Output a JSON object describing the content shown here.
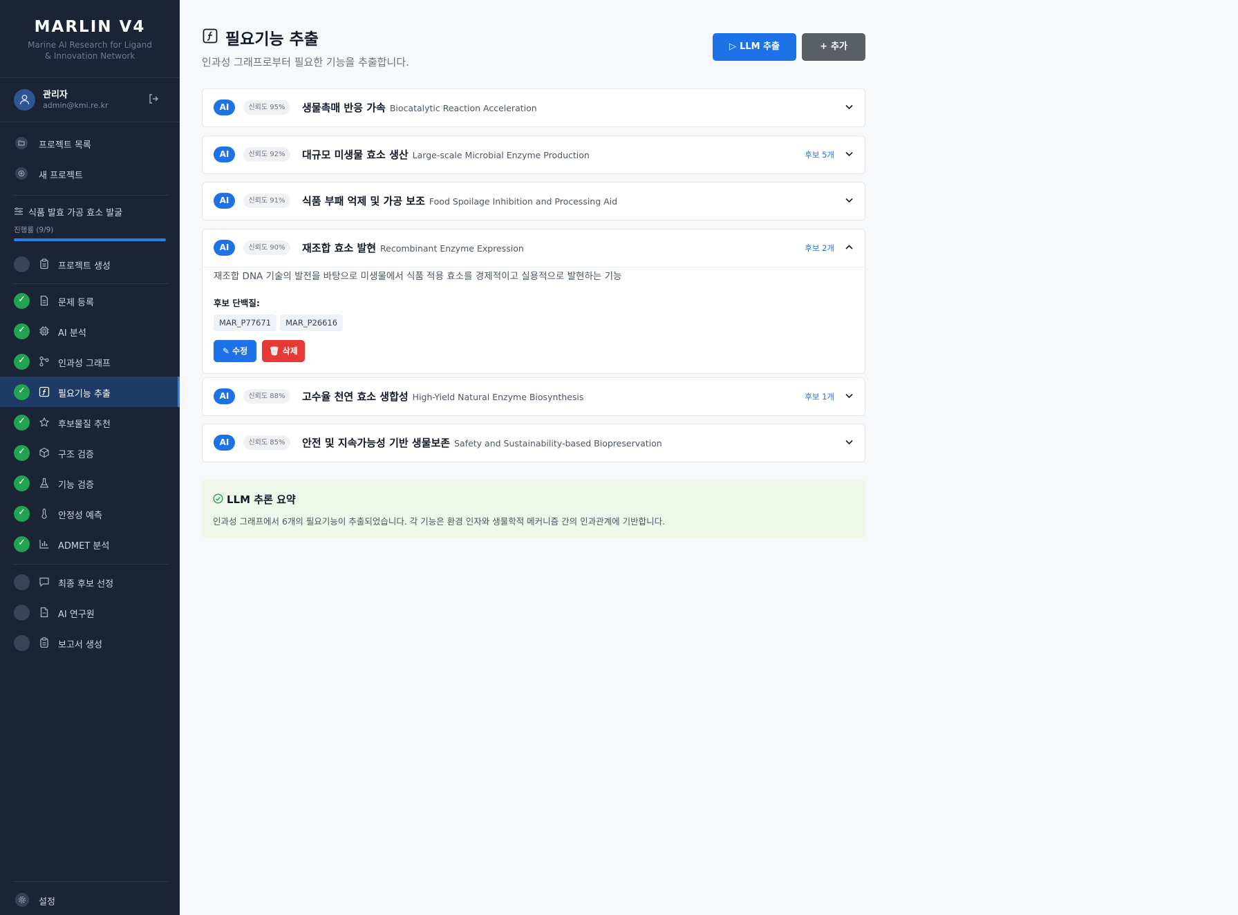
{
  "brand": {
    "title": "MARLIN V4",
    "subtitle_line1": "Marine AI Research for Ligand",
    "subtitle_line2": "& Innovation Network"
  },
  "user": {
    "name": "관리자",
    "email": "admin@kmi.re.kr"
  },
  "nav": {
    "project_list": "프로젝트 목록",
    "new_project": "새 프로젝트"
  },
  "project": {
    "title": "식품 발효 가공 효소 발굴",
    "progress_label": "진행률 (9/9)",
    "progress": 1.0
  },
  "steps": [
    {
      "label": "프로젝트 생성",
      "done": false,
      "icon": "clipboard-icon"
    },
    {
      "label": "문제 등록",
      "done": true,
      "icon": "document-icon"
    },
    {
      "label": "AI 분석",
      "done": true,
      "icon": "cpu-icon"
    },
    {
      "label": "인과성 그래프",
      "done": true,
      "icon": "graph-icon"
    },
    {
      "label": "필요기능 추출",
      "done": true,
      "icon": "function-icon",
      "active": true
    },
    {
      "label": "후보물질 추천",
      "done": true,
      "icon": "star-icon"
    },
    {
      "label": "구조 검증",
      "done": true,
      "icon": "cube-icon"
    },
    {
      "label": "기능 검증",
      "done": true,
      "icon": "flask-icon"
    },
    {
      "label": "안정성 예측",
      "done": true,
      "icon": "thermometer-icon"
    },
    {
      "label": "ADMET 분석",
      "done": true,
      "icon": "bar-chart-icon"
    },
    {
      "label": "최종 후보 선정",
      "done": false,
      "icon": "message-icon"
    },
    {
      "label": "AI 연구원",
      "done": false,
      "icon": "file-icon"
    },
    {
      "label": "보고서 생성",
      "done": false,
      "icon": "clipboard-icon"
    }
  ],
  "settings_label": "설정",
  "header": {
    "title": "필요기능 추출",
    "subtitle": "인과성 그래프로부터 필요한 기능을 추출합니다.",
    "llm_button": "LLM 추출",
    "add_button": "추가"
  },
  "functions": [
    {
      "badge": "AI",
      "confidence": "신뢰도 95%",
      "title": "생물촉매 반응 가속",
      "title_en": "Biocatalytic Reaction Acceleration",
      "candidates": "",
      "expanded": false
    },
    {
      "badge": "AI",
      "confidence": "신뢰도 92%",
      "title": "대규모 미생물 효소 생산",
      "title_en": "Large-scale Microbial Enzyme Production",
      "candidates": "후보 5개",
      "expanded": false
    },
    {
      "badge": "AI",
      "confidence": "신뢰도 91%",
      "title": "식품 부패 억제 및 가공 보조",
      "title_en": "Food Spoilage Inhibition and Processing Aid",
      "candidates": "",
      "expanded": false
    },
    {
      "badge": "AI",
      "confidence": "신뢰도 90%",
      "title": "재조합 효소 발현",
      "title_en": "Recombinant Enzyme Expression",
      "candidates": "후보 2개",
      "expanded": true,
      "description": "재조합 DNA 기술의 발전을 바탕으로 미생물에서 식품 적용 효소를 경제적이고 실용적으로 발현하는 기능",
      "candidate_label": "후보 단백질:",
      "proteins": [
        "MAR_P77671",
        "MAR_P26616"
      ],
      "edit_button": "수정",
      "delete_button": "삭제"
    },
    {
      "badge": "AI",
      "confidence": "신뢰도 88%",
      "title": "고수율 천연 효소 생합성",
      "title_en": "High-Yield Natural Enzyme Biosynthesis",
      "candidates": "후보 1개",
      "expanded": false
    },
    {
      "badge": "AI",
      "confidence": "신뢰도 85%",
      "title": "안전 및 지속가능성 기반 생물보존",
      "title_en": "Safety and Sustainability-based Biopreservation",
      "candidates": "",
      "expanded": false
    }
  ],
  "summary": {
    "title": "LLM 추론 요약",
    "text": "인과성 그래프에서 6개의 필요기능이 추출되었습니다. 각 기능은 환경 인자와 생물학적 메커니즘 간의 인과관계에 기반합니다."
  },
  "colors": {
    "sidebar_bg": "#1b2434",
    "accent": "#1d72e8",
    "done_green": "#22a352",
    "delete_red": "#e53935",
    "summary_bg": "#eef7e9"
  }
}
